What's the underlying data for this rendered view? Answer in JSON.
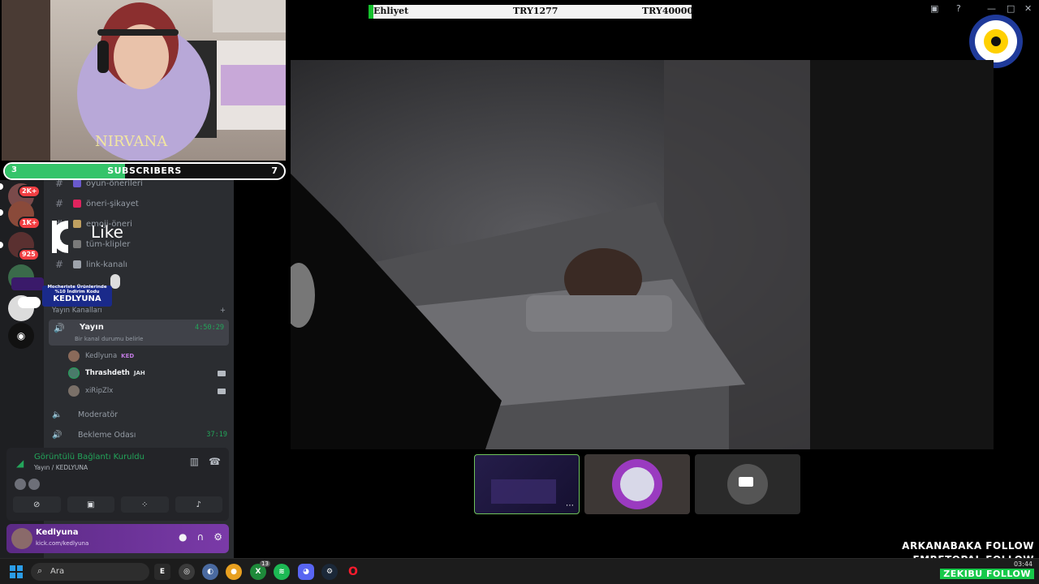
{
  "ticker": {
    "label": "Ehliyet",
    "value1": "TRY1277",
    "value2": "TRY40000"
  },
  "subscribers": {
    "current": "3",
    "label": "SUBSCRIBERS",
    "goal": "7",
    "progress": 0.43
  },
  "overlay": {
    "like_text": "Like",
    "promo_line": "Mocheriste Ürünlerinde %10 İndirim Kodu",
    "promo_code": "KEDLYUNA"
  },
  "server_rail": {
    "badges": [
      "2K+",
      "1K+",
      "925"
    ]
  },
  "channels": [
    {
      "name": "oyun-önerileri",
      "color": "#6a5acd"
    },
    {
      "name": "öneri-şikayet",
      "color": "#e0245e"
    },
    {
      "name": "emoji-öneri",
      "color": "#c0a060"
    },
    {
      "name": "tüm-klipler",
      "color": "#7a7a7a"
    },
    {
      "name": "link-kanalı",
      "color": "#9ea3ab"
    }
  ],
  "category": {
    "label": "Yayın Kanalları",
    "add": "+"
  },
  "voice_channel": {
    "name": "Yayın",
    "time": "4:50:29",
    "status": "Bir kanal durumu belirle"
  },
  "members": [
    {
      "name": "Kedlyuna",
      "tag": "KED",
      "tag_color": "#c07ae0",
      "camera": false
    },
    {
      "name": "Thrashdeth",
      "tag": "JAH",
      "tag_color": "#dbdee1",
      "camera": true
    },
    {
      "name": "xiRipZlx",
      "tag": "",
      "tag_color": "#dbdee1",
      "camera": true
    }
  ],
  "other_channels": [
    {
      "name": "Moderatör",
      "time": ""
    },
    {
      "name": "Bekleme Odası",
      "time": "37:19"
    }
  ],
  "voice_panel": {
    "title": "Görüntülü Bağlantı Kuruldu",
    "subtitle": "Yayın / KEDLYUNA"
  },
  "user_panel": {
    "name": "Kedlyuna",
    "subtitle": "kick.com/kedlyuna"
  },
  "follows": [
    "ARKANABAKA FOLLOW",
    "EMRETOPAL FOLLOW",
    "ZEKIBU FOLLOW"
  ],
  "taskbar": {
    "search_placeholder": "Ara",
    "time": "03:44",
    "app_badge": "13"
  },
  "colors": {
    "discord_bg": "#2b2d31",
    "rail_bg": "#1e1f22",
    "online_green": "#23a55a",
    "ticker_green": "#16c12e"
  }
}
